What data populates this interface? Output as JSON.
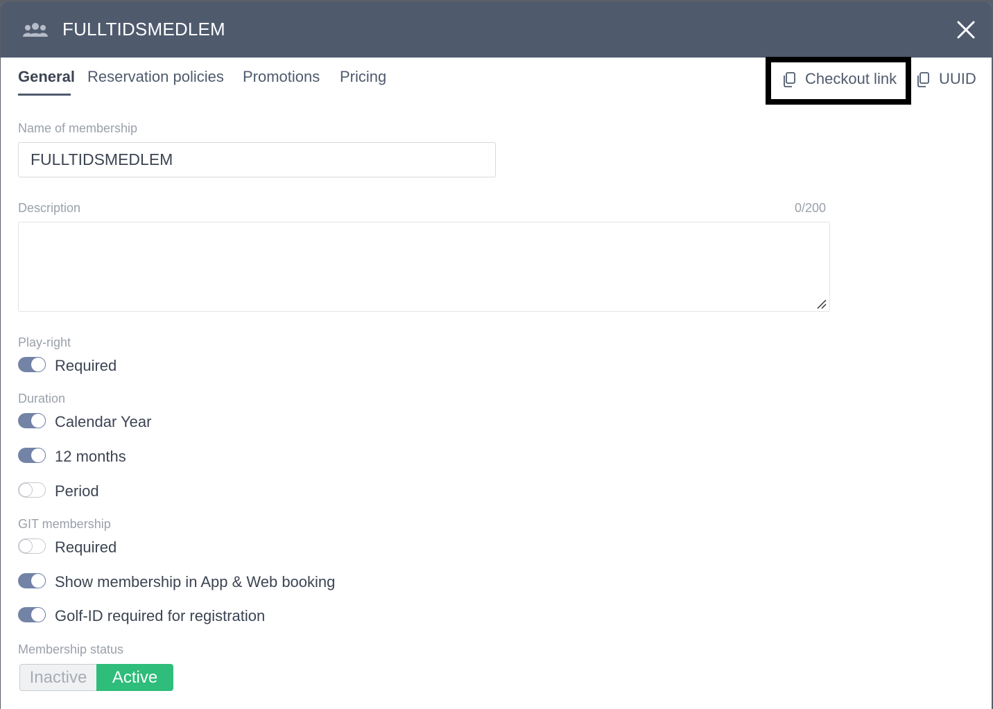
{
  "header": {
    "icon": "group-icon",
    "title": "FULLTIDSMEDLEM",
    "close_icon": "close-icon"
  },
  "tabs": [
    {
      "label": "General",
      "active": true
    },
    {
      "label": "Reservation policies",
      "active": false
    },
    {
      "label": "Promotions",
      "active": false
    },
    {
      "label": "Pricing",
      "active": false
    }
  ],
  "actions": {
    "checkout_link": "Checkout link",
    "uuid": "UUID",
    "icon": "copy-icon"
  },
  "form": {
    "name_label": "Name of membership",
    "name_value": "FULLTIDSMEDLEM",
    "description_label": "Description",
    "description_counter": "0/200",
    "description_value": "",
    "play_right_label": "Play-right",
    "play_right_required": {
      "label": "Required",
      "on": true
    },
    "duration_label": "Duration",
    "duration_options": [
      {
        "label": "Calendar Year",
        "on": true
      },
      {
        "label": "12 months",
        "on": true
      },
      {
        "label": "Period",
        "on": false
      }
    ],
    "git_label": "GIT membership",
    "git_required": {
      "label": "Required",
      "on": false
    },
    "show_in_app": {
      "label": "Show membership in App & Web booking",
      "on": true
    },
    "golf_id_required": {
      "label": "Golf-ID required for registration",
      "on": true
    },
    "status_label": "Membership status",
    "status_inactive": "Inactive",
    "status_active": "Active",
    "status_selected": "Active"
  },
  "colors": {
    "header_bg": "#4f5a6d",
    "toggle_on": "#7283a6",
    "active_green": "#2ebd7a"
  }
}
